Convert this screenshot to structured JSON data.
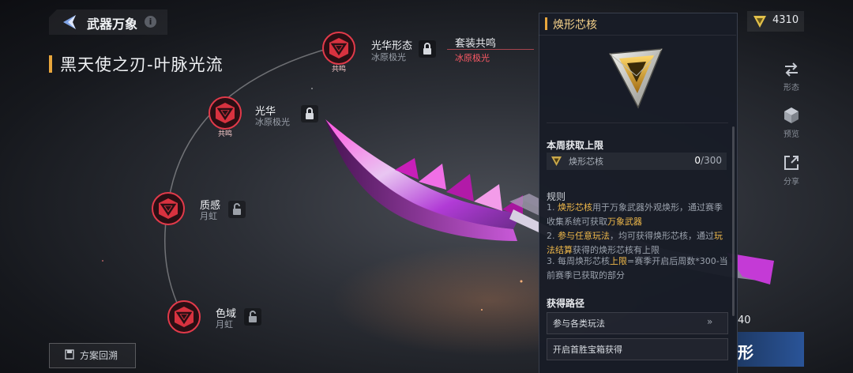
{
  "header": {
    "title": "武器万象",
    "info": "i"
  },
  "weapon": {
    "name": "黑天使之刃-叶脉光流"
  },
  "nodes": [
    {
      "title": "光华形态",
      "sub": "冰原极光",
      "badge": "共鸣",
      "locked": true
    },
    {
      "title": "光华",
      "sub": "冰原极光",
      "badge": "共鸣",
      "locked": true
    },
    {
      "title": "质感",
      "sub": "月虹",
      "badge": "",
      "locked": false
    },
    {
      "title": "色域",
      "sub": "月虹",
      "badge": "",
      "locked": false
    }
  ],
  "suit": {
    "title": "套装共鸣",
    "sub": "冰原极光"
  },
  "plan_button": {
    "label": "方案回溯"
  },
  "currency": {
    "icon": "core-triangle-icon",
    "value": "4310"
  },
  "side_actions": [
    {
      "icon": "swap-icon",
      "label": "形态"
    },
    {
      "icon": "3d-cube-icon",
      "label": "预览"
    },
    {
      "icon": "share-icon",
      "label": "分享"
    }
  ],
  "right_count": "40",
  "use_button": {
    "label": "形"
  },
  "panel": {
    "title": "焕形芯核",
    "weekly_heading": "本周获取上限",
    "item_name": "焕形芯核",
    "current": "0",
    "limit": "/300",
    "rules_heading": "规则",
    "rule1_a": "1. ",
    "rule1_hl": "焕形芯核",
    "rule1_b": "用于万象武器外观焕形，通过赛季收集系统可获取",
    "rule1_hl2": "万象武器",
    "rule2_a": "2. ",
    "rule2_hl": "参与任意玩法",
    "rule2_b": "，均可获得焕形芯核，通过",
    "rule2_hl2": "玩法结算",
    "rule2_c": "获得的焕形芯核有上限",
    "rule3_a": "3. 每周焕形芯核",
    "rule3_hl": "上限",
    "rule3_b": "=赛季开启后周数*300-当前赛季已获取的部分",
    "routes_heading": "获得路径",
    "route1": "参与各类玩法",
    "route2": "开启首胜宝箱获得"
  },
  "colors": {
    "accent": "#e8a63c",
    "highlight": "#f0b94a",
    "node_red": "#e23a4a",
    "panel_bg": "#181c26"
  }
}
